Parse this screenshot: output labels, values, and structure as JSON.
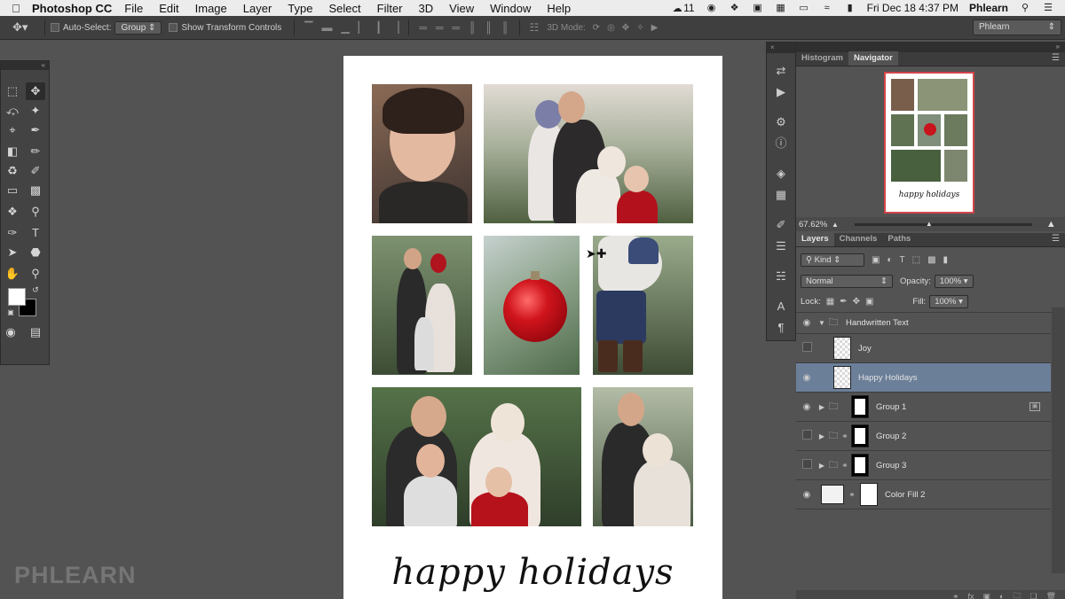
{
  "menubar": {
    "app_name": "Photoshop CC",
    "items": [
      "File",
      "Edit",
      "Image",
      "Layer",
      "Type",
      "Select",
      "Filter",
      "3D",
      "View",
      "Window",
      "Help"
    ],
    "cc_badge": "11",
    "clock": "Fri Dec 18  4:37 PM",
    "user": "Phlearn"
  },
  "options_bar": {
    "auto_select_label": "Auto-Select:",
    "auto_select_value": "Group",
    "show_transform_label": "Show Transform Controls",
    "mode_3d_label": "3D Mode:",
    "workspace": "Phlearn"
  },
  "document": {
    "script_text": "happy holidays",
    "photos": [
      {
        "name": "toddler-portrait",
        "colors": [
          "#7b5c48",
          "#3a3230"
        ]
      },
      {
        "name": "family-holding-toddler",
        "colors": [
          "#dcd6d0",
          "#4f5d3b"
        ]
      },
      {
        "name": "couple-with-child",
        "colors": [
          "#6f8563",
          "#3b4a33"
        ]
      },
      {
        "name": "red-ornament",
        "colors": [
          "#b7c6c3",
          "#5f7a5a"
        ]
      },
      {
        "name": "pregnant-belly",
        "colors": [
          "#8fa082",
          "#3f4e36"
        ]
      },
      {
        "name": "family-sitting",
        "colors": [
          "#4e6a42",
          "#2f3e2a"
        ]
      },
      {
        "name": "couple-embrace",
        "colors": [
          "#a9b39c",
          "#4c5a44"
        ]
      }
    ]
  },
  "watermark": "PHLEARN",
  "panels": {
    "top_tabs": [
      "Histogram",
      "Navigator"
    ],
    "active_top_tab": "Navigator",
    "nav_script": "happy holidays",
    "zoom": "67.62%",
    "zoom_slider_fraction": 0.42,
    "layer_tabs": [
      "Layers",
      "Channels",
      "Paths"
    ],
    "filter_kind": "Kind",
    "blend_mode": "Normal",
    "opacity_label": "Opacity:",
    "opacity_value": "100%",
    "lock_label": "Lock:",
    "fill_label": "Fill:",
    "fill_value": "100%",
    "layers": [
      {
        "name": "Handwritten Text",
        "type": "group",
        "visible": true,
        "expanded": true
      },
      {
        "name": "Joy",
        "type": "text",
        "visible": false
      },
      {
        "name": "Happy Holidays",
        "type": "text",
        "visible": true,
        "selected": true
      },
      {
        "name": "Group 1",
        "type": "group",
        "visible": true
      },
      {
        "name": "Group 2",
        "type": "group",
        "visible": false
      },
      {
        "name": "Group 3",
        "type": "group",
        "visible": false
      },
      {
        "name": "Color Fill 2",
        "type": "fill",
        "visible": true
      }
    ]
  }
}
